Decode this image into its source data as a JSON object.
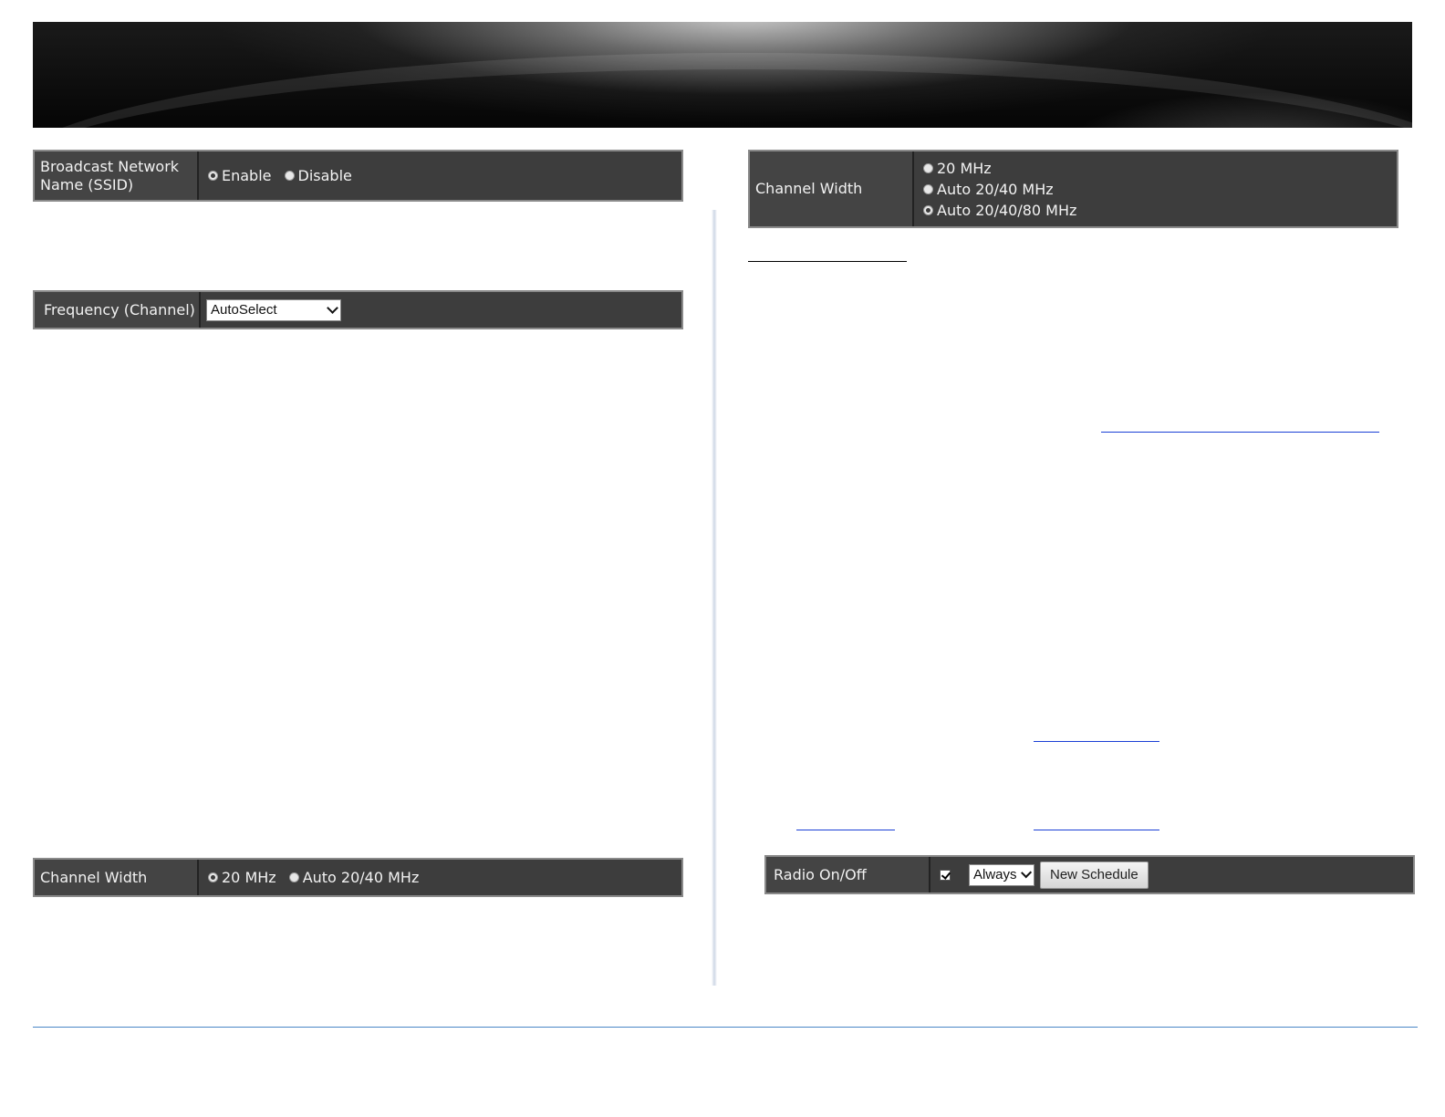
{
  "ssid_panel": {
    "label": "Broadcast Network Name (SSID)",
    "enable": "Enable",
    "disable": "Disable",
    "selected": "Enable"
  },
  "freq_panel": {
    "label": "Frequency (Channel)",
    "selected": "AutoSelect"
  },
  "cw_left": {
    "label": "Channel Width",
    "opt1": "20 MHz",
    "opt2": "Auto 20/40 MHz",
    "selected": "20 MHz"
  },
  "cw_right": {
    "label": "Channel Width",
    "opt1": "20 MHz",
    "opt2": "Auto 20/40 MHz",
    "opt3": "Auto 20/40/80 MHz",
    "selected": "Auto 20/40/80 MHz"
  },
  "radio_panel": {
    "label": "Radio On/Off",
    "checked": true,
    "schedule": "Always",
    "new_schedule": "New Schedule"
  }
}
